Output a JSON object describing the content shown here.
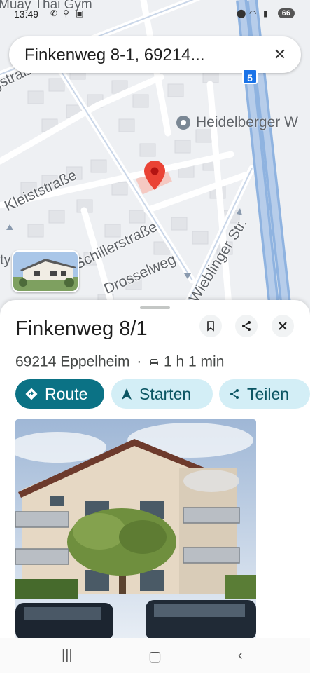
{
  "status_bar": {
    "time": "13:49",
    "battery": "66",
    "overlay_label": "Muay Thai Gym"
  },
  "search": {
    "query": "Finkenweg 8-1, 69214...",
    "close_icon": "close-icon"
  },
  "map": {
    "streets": [
      "Kleiststraße",
      "Schillerstraße",
      "Drosselweg",
      "Wieblinger Str."
    ],
    "street_top_left": "gstraße",
    "poi_label": "Heidelberger W",
    "route_shield": "5",
    "left_edge_text": "ty"
  },
  "place": {
    "title": "Finkenweg 8/1",
    "postal_city": "69214 Eppelheim",
    "separator": "·",
    "drive_time": "1 h 1 min"
  },
  "actions": {
    "route": "Route",
    "start": "Starten",
    "share": "Teilen"
  },
  "colors": {
    "accent": "#0b7285",
    "chip": "#d3eef6",
    "pin": "#ea4335",
    "highway": "#8fb3e0"
  }
}
